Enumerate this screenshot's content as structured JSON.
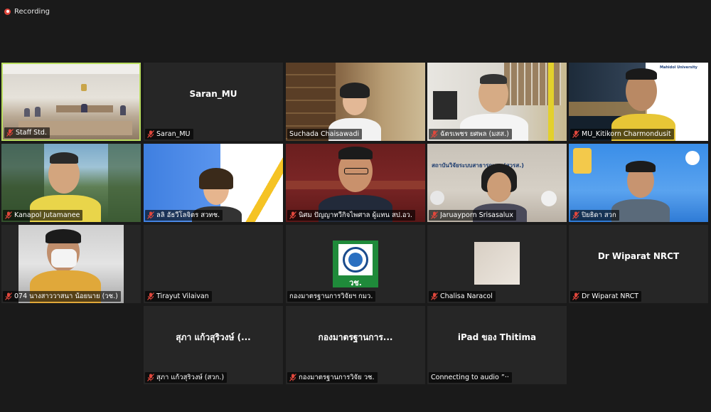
{
  "recording": {
    "label": "Recording"
  },
  "tiles": [
    {
      "name": "Staff Std.",
      "type": "video",
      "muted": true,
      "active": true
    },
    {
      "name": "Saran_MU",
      "center": "Saran_MU",
      "type": "name",
      "muted": true
    },
    {
      "name": "Suchada Chaisawadi",
      "type": "video",
      "muted": false
    },
    {
      "name": "ฉัตรเพชร ยศพล (มสส.)",
      "type": "video",
      "muted": true
    },
    {
      "name": "MU_Kitikorn Charmondusit",
      "type": "video",
      "muted": true,
      "overlay": "Mahidol University"
    },
    {
      "name": "Kanapol Jutamanee",
      "type": "video",
      "muted": true
    },
    {
      "name": "ลลิ อัธวีโลจิตร สวทช.",
      "type": "video",
      "muted": true
    },
    {
      "name": "นิศม ปัญญาทวีกิจไพศาล ผู้แทน สป.อว.",
      "type": "video",
      "muted": true
    },
    {
      "name": "Jaruayporn Srisasalux",
      "type": "video",
      "muted": true,
      "overlay": "สถาบันวิจัยระบบสาธารณสุข (สวรส.)"
    },
    {
      "name": "ปิยธิดา สวก",
      "type": "video",
      "muted": true
    },
    {
      "name": "074 นางสาววาสนา น้อยนาย (วช.)",
      "type": "video",
      "muted": true
    },
    {
      "name": "Tirayut Vilaivan",
      "type": "blank",
      "muted": true
    },
    {
      "name": "กองมาตรฐานการวิจัยฯ กมว.",
      "type": "logo",
      "muted": false,
      "logo_text": "วช."
    },
    {
      "name": "Chalisa Naracol",
      "type": "image",
      "muted": true
    },
    {
      "name": "Dr Wiparat NRCT",
      "center": "Dr Wiparat NRCT",
      "type": "name",
      "muted": true
    },
    {
      "name": "สุภา แก้วสุริวงษ์ (สวก.)",
      "center": "สุภา แก้วสุริวงษ์ (...",
      "type": "name",
      "muted": true
    },
    {
      "name": "กองมาตรฐานการวิจัย วช.",
      "center": "กองมาตรฐานการ...",
      "type": "name",
      "muted": true
    },
    {
      "name": "Connecting to audio ”··",
      "center": "iPad ของ Thitima",
      "type": "name",
      "muted": false
    }
  ],
  "colors": {
    "background": "#1a1a1a",
    "tile": "#262626",
    "active_border": "#b9dd5f",
    "muted_icon": "#e0473c"
  },
  "icons": {
    "muted": "mic-muted-icon",
    "recording": "recording-dot-icon"
  }
}
